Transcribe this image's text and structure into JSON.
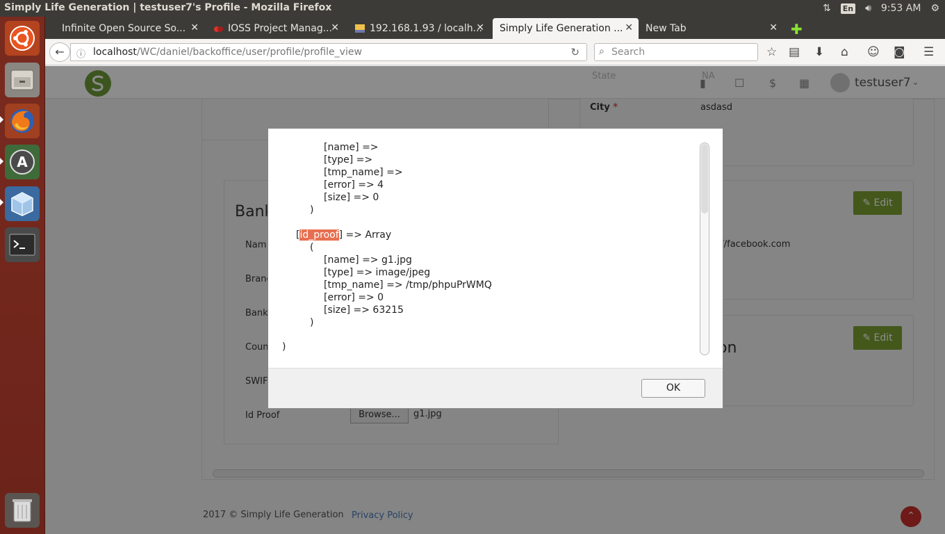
{
  "os": {
    "window_title": "Simply Life Generation | testuser7's Profile - Mozilla Firefox",
    "keyboard_layout": "En",
    "clock": "9:53 AM"
  },
  "browser": {
    "tabs": [
      {
        "label": "Infinite Open Source So...",
        "active": false
      },
      {
        "label": "IOSS Project Manag...",
        "active": false
      },
      {
        "label": "192.168.1.93 / localh...",
        "active": false
      },
      {
        "label": "Simply Life Generation ...",
        "active": true
      },
      {
        "label": "New Tab",
        "active": false
      }
    ],
    "url_host": "localhost",
    "url_path": "/WC/daniel/backoffice/user/profile/profile_view",
    "search_placeholder": "Search"
  },
  "page": {
    "header": {
      "username": "testuser7",
      "currency_icon": "$"
    },
    "faded_labels": {
      "state_label": "State",
      "state_value": "NA",
      "city_label": "City",
      "city_value": "asdasd",
      "bank_heading": "Bank",
      "name_label": "Nam",
      "branch_label": "Branc",
      "bank_label": "Bank",
      "country_label": "Coun",
      "swift_label": "SWIF",
      "id_proof_label": "Id Proof",
      "browse_button": "Browse...",
      "id_proof_file": "g1.jpg",
      "facebook_partial": "://facebook.com",
      "section_partial": "on",
      "edit_label": "Edit"
    },
    "footer": {
      "copyright": "2017 © Simply Life Generation",
      "privacy_link": "Privacy Policy"
    }
  },
  "dialog": {
    "lines": [
      "[name] =>",
      "[type] =>",
      "[tmp_name] =>",
      "[error] => 4",
      "[size] => 0",
      ")",
      "[",
      "id_proof",
      "] => Array",
      "(",
      "[name] => g1.jpg",
      "[type] => image/jpeg",
      "[tmp_name] => /tmp/phpuPrWMQ",
      "[error] => 0",
      "[size] => 63215",
      ")",
      ")"
    ],
    "ok_label": "OK"
  }
}
